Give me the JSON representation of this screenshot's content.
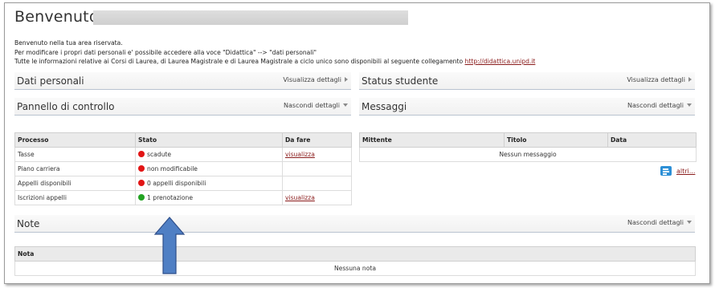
{
  "page_title": "Benvenuto",
  "intro": {
    "line1": "Benvenuto nella tua area riservata.",
    "line2": "Per modificare i propri dati personali e' possibile accedere alla voce \"Didattica\" --> \"dati personali\"",
    "line3": "Tutte le informazioni relative ai Corsi di Laurea, di Laurea Magistrale e di Laurea Magistrale a ciclo unico sono disponibili al seguente collegamento",
    "link": "http://didattica.unipd.it"
  },
  "panels": {
    "dati_personali": {
      "title": "Dati personali",
      "action": "Visualizza dettagli"
    },
    "status_studente": {
      "title": "Status studente",
      "action": "Visualizza dettagli"
    },
    "pannello": {
      "title": "Pannello di controllo",
      "action": "Nascondi dettagli"
    },
    "messaggi": {
      "title": "Messaggi",
      "action": "Nascondi dettagli"
    },
    "note": {
      "title": "Note",
      "action": "Nascondi dettagli"
    }
  },
  "control_table": {
    "headers": [
      "Processo",
      "Stato",
      "Da fare"
    ],
    "rows": [
      {
        "processo": "Tasse",
        "stato": "scadute",
        "status_color": "#e21515",
        "da_fare": "visualizza"
      },
      {
        "processo": "Piano carriera",
        "stato": "non modificabile",
        "status_color": "#e21515",
        "da_fare": ""
      },
      {
        "processo": "Appelli disponibili",
        "stato": "0 appelli disponibili",
        "status_color": "#e21515",
        "da_fare": ""
      },
      {
        "processo": "Iscrizioni appelli",
        "stato": "1 prenotazione",
        "status_color": "#22a322",
        "da_fare": "visualizza"
      }
    ]
  },
  "messages_table": {
    "headers": [
      "Mittente",
      "Titolo",
      "Data"
    ],
    "empty": "Nessun messaggio"
  },
  "altri_link": "altri...",
  "notes_table": {
    "header": "Nota",
    "empty": "Nessuna nota"
  },
  "colors": {
    "link": "#8a1b1b",
    "status_red": "#e21515",
    "status_green": "#22a322",
    "arrow": "#4f7fc4"
  }
}
